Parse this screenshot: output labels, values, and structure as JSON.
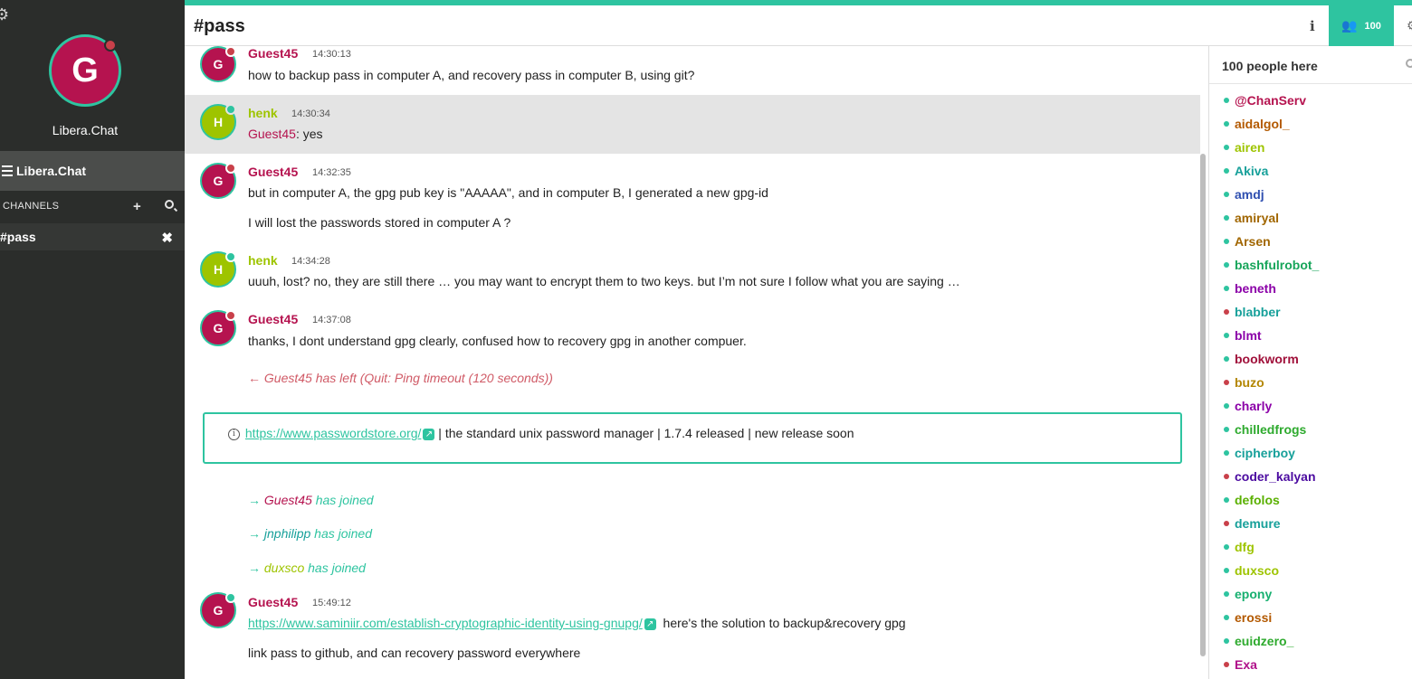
{
  "sidebar": {
    "network_initial": "G",
    "network_name": "Libera.Chat",
    "server_label": "Libera.Chat",
    "channels_label": "CHANNELS",
    "channel": "#pass"
  },
  "header": {
    "channel_title": "#pass",
    "info_label": "i",
    "user_count": "100"
  },
  "messages": {
    "m1": {
      "initial": "G",
      "nick": "Guest45",
      "time": "14:30:13",
      "text": "how to backup pass in computer A, and recovery pass in computer B, using git?"
    },
    "m2": {
      "initial": "H",
      "nick": "henk",
      "time": "14:30:34",
      "mention": "Guest45",
      "text": ": yes"
    },
    "m3": {
      "initial": "G",
      "nick": "Guest45",
      "time": "14:32:35",
      "text": "but in computer A, the gpg pub key is \"AAAAA\", and in computer B, I generated a new gpg-id",
      "text2": "I will lost the passwords stored in computer A ?"
    },
    "m4": {
      "initial": "H",
      "nick": "henk",
      "time": "14:34:28",
      "text": "uuuh, lost? no, they are still there … you may want to encrypt them to two keys. but I’m not sure I follow what you are saying …"
    },
    "m5": {
      "initial": "G",
      "nick": "Guest45",
      "time": "14:37:08",
      "text": "thanks, I dont  understand gpg clearly, confused how to recovery   gpg in another compuer."
    },
    "quit": {
      "arrow": "←",
      "text": "Guest45 has left (Quit: Ping timeout (120 seconds))"
    },
    "topic": {
      "link": "https://www.passwordstore.org/",
      "text": " | the standard unix password manager | 1.7.4 released | new release soon"
    },
    "join1": {
      "arrow": "→",
      "nick": "Guest45",
      "text": " has joined"
    },
    "join2": {
      "arrow": "→",
      "nick": "jnphilipp",
      "text": " has joined"
    },
    "join3": {
      "arrow": "→",
      "nick": "duxsco",
      "text": " has joined"
    },
    "m6": {
      "initial": "G",
      "nick": "Guest45",
      "time": "15:49:12",
      "link": "https://www.saminiir.com/establish-cryptographic-identity-using-gnupg/",
      "text": "  here's the solution to backup&recovery gpg",
      "text2": "link pass to github, and can recovery password everywhere"
    }
  },
  "userlist": {
    "count_label": "100 people here",
    "users": [
      {
        "nick": "@ChanServ",
        "color": "#b5134f",
        "status": "#2ec4a0"
      },
      {
        "nick": "aidalgol_",
        "color": "#b35900",
        "status": "#2ec4a0"
      },
      {
        "nick": "airen",
        "color": "#9ec400",
        "status": "#2ec4a0"
      },
      {
        "nick": "Akiva",
        "color": "#17a09a",
        "status": "#2ec4a0"
      },
      {
        "nick": "amdj",
        "color": "#2f4fb0",
        "status": "#2ec4a0"
      },
      {
        "nick": "amiryal",
        "color": "#a16600",
        "status": "#2ec4a0"
      },
      {
        "nick": "Arsen",
        "color": "#a16600",
        "status": "#2ec4a0"
      },
      {
        "nick": "bashfulrobot_",
        "color": "#17a55a",
        "status": "#2ec4a0"
      },
      {
        "nick": "beneth",
        "color": "#8b00a8",
        "status": "#2ec4a0"
      },
      {
        "nick": "blabber",
        "color": "#17a09a",
        "status": "#c9404a"
      },
      {
        "nick": "blmt",
        "color": "#8b00a8",
        "status": "#2ec4a0"
      },
      {
        "nick": "bookworm",
        "color": "#a0103a",
        "status": "#2ec4a0"
      },
      {
        "nick": "buzo",
        "color": "#b38600",
        "status": "#c9404a"
      },
      {
        "nick": "charly",
        "color": "#8b00a8",
        "status": "#2ec4a0"
      },
      {
        "nick": "chilledfrogs",
        "color": "#2eaa2e",
        "status": "#2ec4a0"
      },
      {
        "nick": "cipherboy",
        "color": "#17a09a",
        "status": "#2ec4a0"
      },
      {
        "nick": "coder_kalyan",
        "color": "#4b0aa0",
        "status": "#c9404a"
      },
      {
        "nick": "defolos",
        "color": "#5ab000",
        "status": "#2ec4a0"
      },
      {
        "nick": "demure",
        "color": "#17a09a",
        "status": "#c9404a"
      },
      {
        "nick": "dfg",
        "color": "#9ec400",
        "status": "#2ec4a0"
      },
      {
        "nick": "duxsco",
        "color": "#9ec400",
        "status": "#2ec4a0"
      },
      {
        "nick": "epony",
        "color": "#17b070",
        "status": "#2ec4a0"
      },
      {
        "nick": "erossi",
        "color": "#b35900",
        "status": "#2ec4a0"
      },
      {
        "nick": "euidzero_",
        "color": "#2eaa2e",
        "status": "#2ec4a0"
      },
      {
        "nick": "Exa",
        "color": "#b0108a",
        "status": "#c9404a"
      }
    ]
  },
  "colors": {
    "accent": "#2ec4a0",
    "guest_nick": "#b5134f",
    "henk_nick": "#9ec400",
    "quit": "#d05a66",
    "offline": "#c9404a"
  }
}
